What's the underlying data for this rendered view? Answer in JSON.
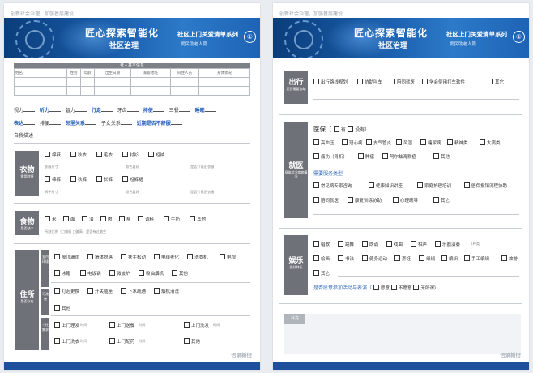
{
  "header": {
    "tagline": "创新社会治理，加强基层建设",
    "title_main": "匠心探索智能化",
    "title_sub": "社区治理",
    "series": "社区上门关爱清单系列",
    "series_sub": "爱民助老人篇",
    "watermark": "悟录新街"
  },
  "page1": {
    "page_number": "①",
    "table": {
      "title": "老人基本信息",
      "headers": [
        "姓名",
        "性别",
        "年龄",
        "出生日期",
        "家庭地址",
        "同住人员",
        "身体状况"
      ]
    },
    "abilities": {
      "items": [
        {
          "label": "视力",
          "value": "听力"
        },
        {
          "label": "智力",
          "value": "行走"
        },
        {
          "label": "牙齿",
          "value": "排便"
        },
        {
          "label": "三餐",
          "value": "睡眠"
        }
      ]
    },
    "relations": {
      "items": [
        {
          "label": "表达",
          "value": "排便"
        },
        {
          "label": "",
          "value": "邻里关系"
        },
        {
          "label": "子女关系",
          "value": "近期是否不舒服"
        }
      ]
    },
    "self_desc": "自我描述",
    "clothing": {
      "title": "衣物",
      "subtitle": "需用除掉",
      "row1": [
        "棉袄",
        "秋衣",
        "毛衣",
        "衬衫",
        "短袖"
      ],
      "row2_small": [
        "衣服尺寸",
        "颜色喜好",
        "是否介意旧衣服"
      ],
      "row3": [
        "棉裤",
        "秋裤",
        "长裤",
        "短裤裙"
      ],
      "row4_small": [
        "裤子尺寸",
        "颜色喜好",
        "是否介意旧衣服"
      ]
    },
    "food": {
      "title": "食物",
      "subtitle": "是否缺少",
      "items": [
        "米",
        "面",
        "油",
        "肉",
        "盐",
        "调料",
        "牛奶",
        "其他"
      ],
      "small": "所缺比例（□偏低 □偏高）是否有过敏史"
    },
    "housing": {
      "title": "住所",
      "subtitle": "是否存在",
      "sub1": "室内环境",
      "sub2": "可改善",
      "sub3": "个性需求",
      "row1": [
        "屋顶漏雨",
        "墙体脱落",
        "扶手松动",
        "电线老化",
        "洗衣机",
        "电视"
      ],
      "row2": [
        "冰箱",
        "电饭锅",
        "微波炉",
        "吸油烟机",
        "其他"
      ],
      "row3": [
        "灯泡更换",
        "开关插座",
        "下水疏通",
        "烟机清洗"
      ],
      "row4": [
        "其他"
      ],
      "row5": [
        "上门理发",
        "上门送餐",
        "上门洗发"
      ],
      "row5_small": [
        "时间",
        "时间",
        "时间"
      ],
      "row6": [
        "上门洗衣",
        "上门配药",
        "其他"
      ],
      "row6_small": [
        "时间",
        "时间"
      ]
    }
  },
  "page2": {
    "page_number": "②",
    "travel": {
      "title": "出行",
      "subtitle": "是否需要协助",
      "items": [
        "出行路线规划",
        "协助叫车",
        "陪同就医",
        "学会使用打车软件",
        "其它"
      ]
    },
    "medical": {
      "title": "就医",
      "subtitle": "身体状况疾病情况",
      "insurance_label": "医保（",
      "insurance_yes": "有",
      "insurance_no": "没有）",
      "row1": [
        "高血压",
        "冠心病",
        "支气管炎",
        "风湿",
        "糖尿病",
        "精神类",
        "大病类"
      ],
      "row2": [
        "痛伤（骨折）",
        "肿瘤",
        "阿尔兹海默症",
        "其他"
      ],
      "service_label": "需要服务类型",
      "row3": [
        "常见病专家咨询",
        "健康知识讲座",
        "家庭护理培训",
        "医保报销流程协助"
      ],
      "row4": [
        "陪同就医",
        "康复训练协助",
        "心理疏导",
        "其它"
      ]
    },
    "entertainment": {
      "title": "娱乐",
      "subtitle": "爱好特长",
      "row1": [
        "唱歌",
        "跳舞",
        "朗诵",
        "戏曲",
        "相声",
        "乐器演奏"
      ],
      "row1_small": "(种类",
      "row2": [
        "绘画",
        "书法",
        "健身运动",
        "烹饪",
        "织绢",
        "编织",
        "手工编织",
        "旅游"
      ],
      "row3": [
        "其它"
      ],
      "question": "是否愿意参加活动与表演（",
      "q_options": [
        "愿意",
        "不愿意",
        "无所谓）"
      ]
    },
    "note_label": "补充"
  }
}
